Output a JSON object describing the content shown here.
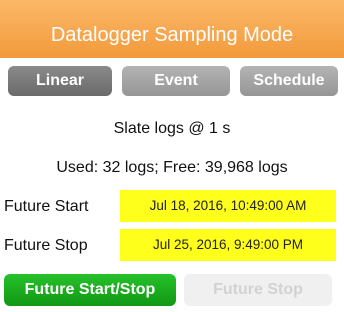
{
  "header": {
    "title": "Datalogger Sampling Mode"
  },
  "mode_tabs": [
    {
      "label": "Linear",
      "selected": true
    },
    {
      "label": "Event",
      "selected": false
    },
    {
      "label": "Schedule",
      "selected": false
    }
  ],
  "status": {
    "sample_rate": "Slate logs @ 1 s",
    "usage": "Used: 32 logs; Free: 39,968 logs"
  },
  "future_start": {
    "label": "Future Start",
    "value": "Jul 18, 2016, 10:49:00 AM"
  },
  "future_stop": {
    "label": "Future Stop",
    "value": "Jul 25, 2016, 9:49:00 PM"
  },
  "actions": {
    "future_start_stop": "Future Start/Stop",
    "future_stop": "Future Stop"
  },
  "colors": {
    "header": "#f5a444",
    "date_field": "#ffff1c",
    "primary_button": "#19a91c",
    "tab_selected": "#7a7a7a",
    "tab": "#a5a5a5"
  }
}
